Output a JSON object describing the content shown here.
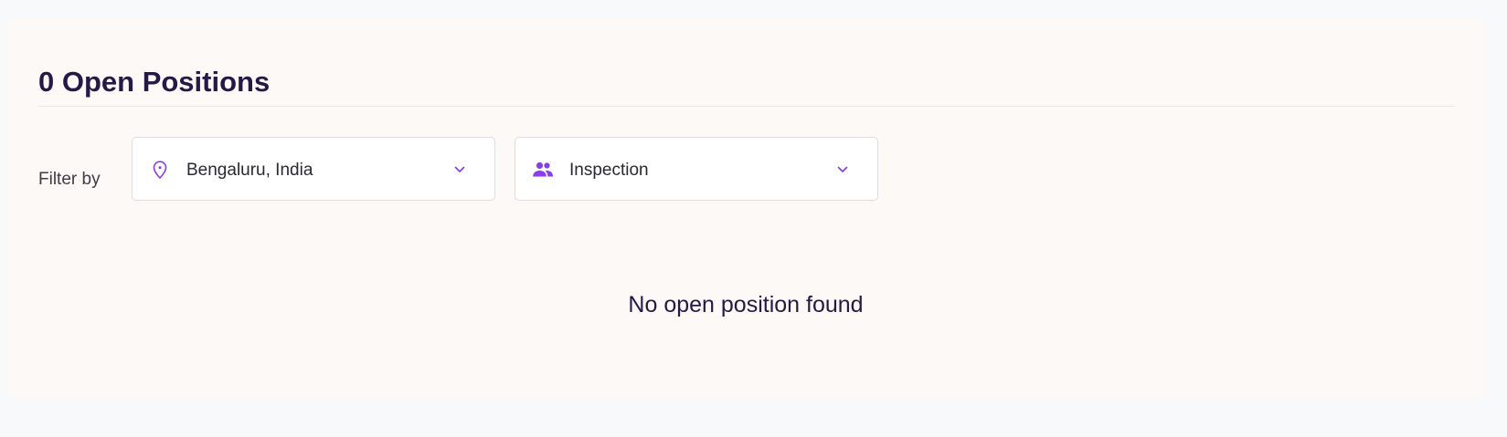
{
  "header": {
    "title": "0 Open Positions"
  },
  "filters": {
    "label": "Filter by",
    "location": {
      "icon": "map-pin-icon",
      "value": "Bengaluru, India"
    },
    "team": {
      "icon": "people-icon",
      "value": "Inspection"
    }
  },
  "empty_state": {
    "message": "No open position found"
  },
  "colors": {
    "accent": "#8a3ee8",
    "title": "#241a48",
    "panel_bg": "#fcf9f6",
    "page_bg": "#f8f9fb"
  }
}
